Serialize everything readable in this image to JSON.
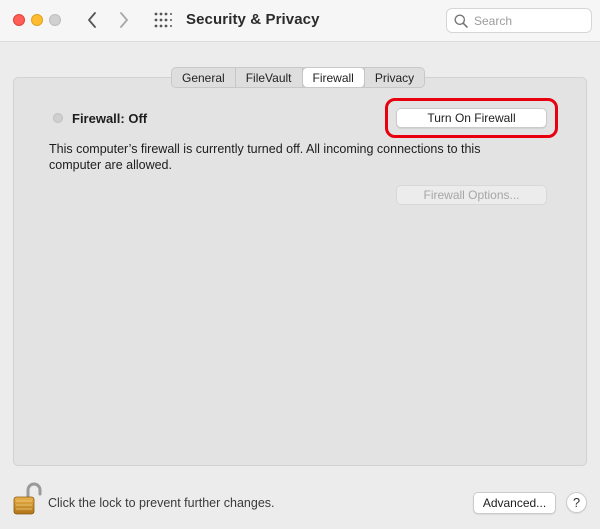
{
  "window": {
    "title": "Security & Privacy"
  },
  "search": {
    "placeholder": "Search",
    "value": ""
  },
  "tabs": [
    {
      "label": "General",
      "active": false
    },
    {
      "label": "FileVault",
      "active": false
    },
    {
      "label": "Firewall",
      "active": true
    },
    {
      "label": "Privacy",
      "active": false
    }
  ],
  "firewall": {
    "status_label": "Firewall: Off",
    "turn_on_label": "Turn On Firewall",
    "description": "This computer’s firewall is currently turned off. All incoming connections to this computer are allowed.",
    "options_label": "Firewall Options..."
  },
  "footer": {
    "lock_text": "Click the lock to prevent further changes.",
    "advanced_label": "Advanced...",
    "help_label": "?"
  },
  "colors": {
    "highlight": "#e8000f",
    "close": "#fe5f57",
    "minimize": "#febc2e",
    "zoom_disabled": "#d0d0d0"
  },
  "icons": [
    "close-button",
    "minimize-button",
    "zoom-button",
    "back-chevron-icon",
    "forward-chevron-icon",
    "grid-icon",
    "search-icon",
    "status-dot-icon",
    "lock-open-icon"
  ]
}
